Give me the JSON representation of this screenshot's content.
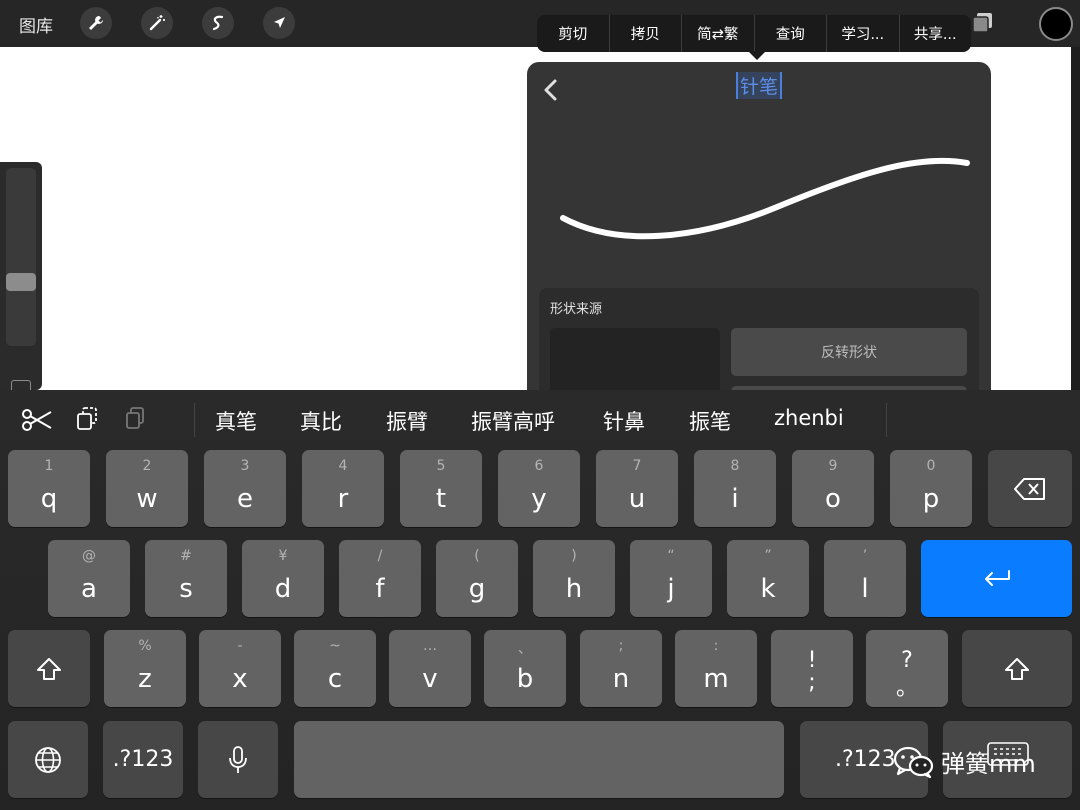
{
  "toolbar": {
    "gallery_label": "图库",
    "tools": [
      "wrench-icon",
      "magic-wand-icon",
      "selection-icon",
      "move-arrow-icon"
    ]
  },
  "edit_menu": {
    "items": [
      "剪切",
      "拷贝",
      "简⇄繁",
      "查询",
      "学习...",
      "共享..."
    ]
  },
  "brush_panel": {
    "brush_name": "针笔",
    "shape_source_title": "形状来源",
    "flip_shape_label": "反转形状"
  },
  "keyboard": {
    "candidates": [
      "真笔",
      "真比",
      "振臂",
      "振臂高呼",
      "针鼻",
      "振笔",
      "zhenbi"
    ],
    "row1": [
      {
        "sec": "1",
        "pri": "q"
      },
      {
        "sec": "2",
        "pri": "w"
      },
      {
        "sec": "3",
        "pri": "e"
      },
      {
        "sec": "4",
        "pri": "r"
      },
      {
        "sec": "5",
        "pri": "t"
      },
      {
        "sec": "6",
        "pri": "y"
      },
      {
        "sec": "7",
        "pri": "u"
      },
      {
        "sec": "8",
        "pri": "i"
      },
      {
        "sec": "9",
        "pri": "o"
      },
      {
        "sec": "0",
        "pri": "p"
      }
    ],
    "row2": [
      {
        "sec": "@",
        "pri": "a"
      },
      {
        "sec": "#",
        "pri": "s"
      },
      {
        "sec": "¥",
        "pri": "d"
      },
      {
        "sec": "/",
        "pri": "f"
      },
      {
        "sec": "(",
        "pri": "g"
      },
      {
        "sec": ")",
        "pri": "h"
      },
      {
        "sec": "“",
        "pri": "j"
      },
      {
        "sec": "”",
        "pri": "k"
      },
      {
        "sec": "’",
        "pri": "l"
      }
    ],
    "row3": [
      {
        "sec": "%",
        "pri": "z"
      },
      {
        "sec": "-",
        "pri": "x"
      },
      {
        "sec": "~",
        "pri": "c"
      },
      {
        "sec": "…",
        "pri": "v"
      },
      {
        "sec": "、",
        "pri": "b"
      },
      {
        "sec": ";",
        "pri": "n"
      },
      {
        "sec": ":",
        "pri": "m"
      }
    ],
    "punct1": {
      "top": "!",
      "bottom": ";"
    },
    "punct2": {
      "top": "?",
      "bottom": "。"
    },
    "numbers_label": ".?123",
    "numbers_label_right": ".?123"
  },
  "watermark": {
    "text": "弹簧mm"
  }
}
